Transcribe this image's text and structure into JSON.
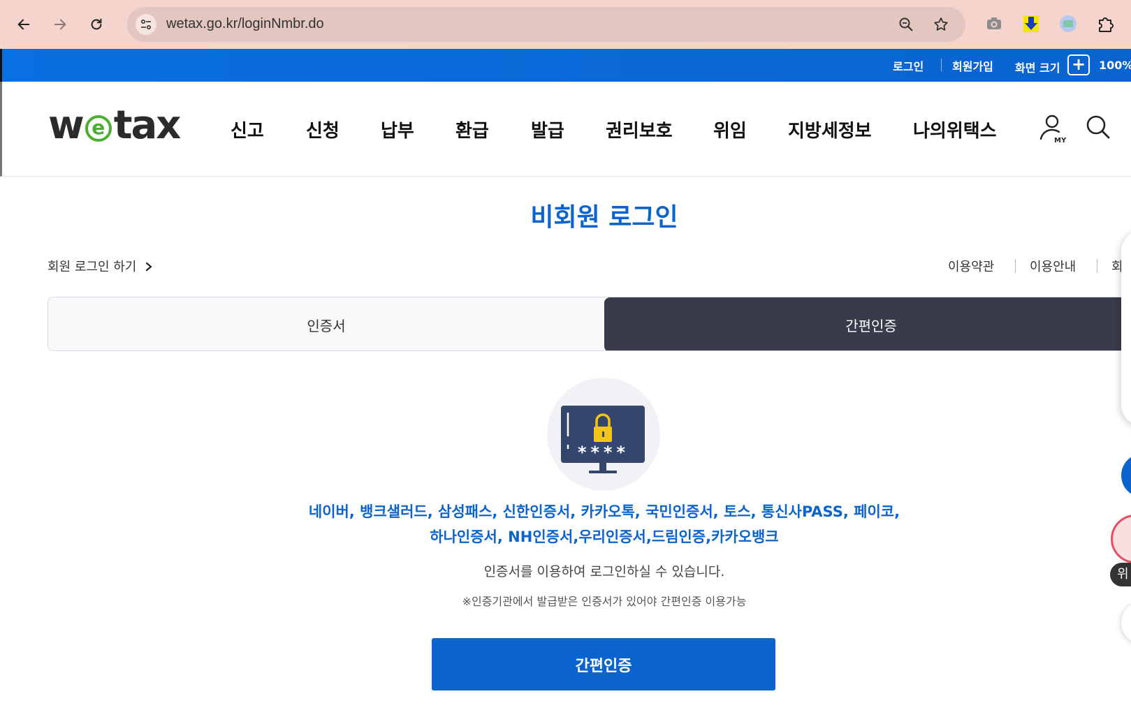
{
  "browser": {
    "url": "wetax.go.kr/loginNmbr.do"
  },
  "topbar": {
    "login": "로그인",
    "signup": "회원가입",
    "screen_size": "화면 크기",
    "zoom_plus": "+",
    "zoom_level": "100%"
  },
  "header": {
    "logo_left": "w",
    "logo_e": "e",
    "logo_right": "tax",
    "nav": [
      "신고",
      "신청",
      "납부",
      "환급",
      "발급",
      "권리보호",
      "위임",
      "지방세정보",
      "나의위택스"
    ],
    "my_label": "MY"
  },
  "main": {
    "title": "비회원 로그인",
    "member_login_link": "회원 로그인 하기",
    "util_links": [
      "이용약관",
      "이용안내",
      "회"
    ],
    "tabs": [
      "인증서",
      "간편인증"
    ],
    "providers_line1": "네이버, 뱅크샐러드, 삼성패스, 신한인증서, 카카오톡, 국민인증서, 토스, 통신사PASS, 페이코,",
    "providers_line2": "하나인증서, NH인증서,우리인증서,드림인증,카카오뱅크",
    "description": "인증서를 이용하여 로그인하실 수 있습니다.",
    "note": "※인증기관에서 발급받은 인증서가 있어야 간편인증 이용가능",
    "submit_button": "간편인증",
    "password_mask": "****"
  },
  "floating": {
    "label": "위"
  },
  "colors": {
    "brand_blue": "#0b63ce",
    "tab_active": "#383c4a",
    "logo_green": "#4caf2f"
  }
}
